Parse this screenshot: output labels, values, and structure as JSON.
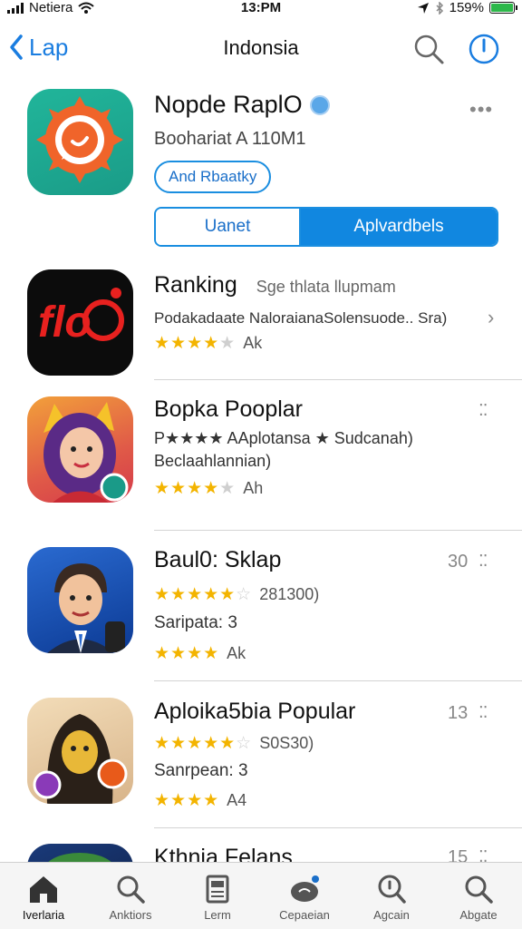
{
  "status_bar": {
    "carrier": "Netiera",
    "time": "13:PM",
    "battery": "159%"
  },
  "nav": {
    "back_label": "Lap",
    "title": "Indonsia"
  },
  "featured": {
    "title": "Nopde RaplO",
    "subtitle": "Boohariat A 110M1",
    "pill_label": "And Rbaatky",
    "segment_left": "Uanet",
    "segment_right": "Aplvardbels"
  },
  "apps": [
    {
      "title": "Ranking",
      "title_suffix": "Sge thlata llupmam",
      "line1": "Podakadaate NaloraianaSolensuode.. Sra)",
      "rating_text": "Ak",
      "rating": 3.5
    },
    {
      "title": "Bopka Pooplar",
      "line1": "P★★★★ AAplotansa ★ Sudcanah)",
      "line2": "Beclaahlannian)",
      "rating_text": "Ah",
      "rating": 4
    },
    {
      "title": "Baul0: Sklap",
      "number": "30",
      "stars_text": "281300)",
      "line1": "Saripata: 3",
      "rating_text": "Ak",
      "rating": 4
    },
    {
      "title": "Aploika5bia Popular",
      "number": "13",
      "stars_text": "S0S30)",
      "line1": "Sanrpean: 3",
      "rating_text": "A4",
      "rating": 4
    },
    {
      "title": "Kthnia Felans",
      "number": "15"
    }
  ],
  "tabs": [
    {
      "label": "Iverlaria",
      "icon": "home-icon"
    },
    {
      "label": "Anktiors",
      "icon": "search-icon"
    },
    {
      "label": "Lerm",
      "icon": "document-icon"
    },
    {
      "label": "Cepaeian",
      "icon": "cloud-icon"
    },
    {
      "label": "Agcain",
      "icon": "search-icon"
    },
    {
      "label": "Abgate",
      "icon": "search-icon"
    }
  ],
  "colors": {
    "accent": "#1187e0",
    "star": "#f3b400"
  }
}
